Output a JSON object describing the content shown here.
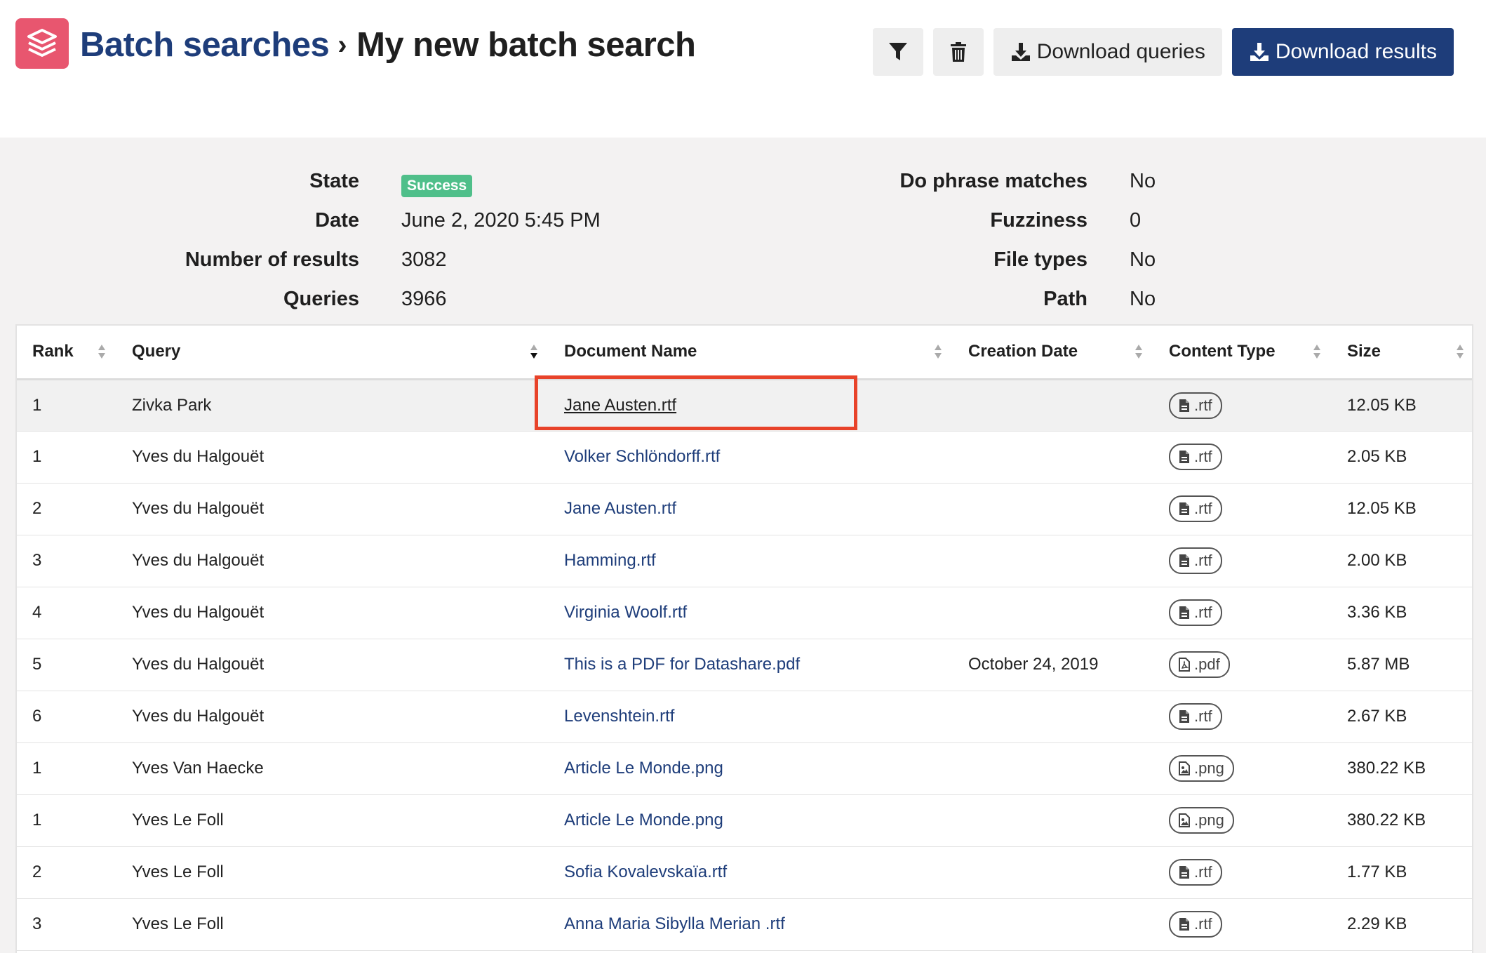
{
  "header": {
    "breadcrumb": "Batch searches",
    "separator": "›",
    "title": "My new batch search",
    "logo_icon": "layers-icon",
    "brand_color": "#e8566f",
    "accent_color": "#1e3d7a"
  },
  "toolbar": {
    "filter_icon": "filter-icon",
    "delete_icon": "trash-icon",
    "download_queries_label": "Download queries",
    "download_results_label": "Download results"
  },
  "info": {
    "left": [
      {
        "label": "State",
        "value": "Success",
        "badge": true
      },
      {
        "label": "Date",
        "value": "June 2, 2020 5:45 PM"
      },
      {
        "label": "Number of results",
        "value": "3082"
      },
      {
        "label": "Queries",
        "value": "3966"
      }
    ],
    "right": [
      {
        "label": "Do phrase matches",
        "value": "No"
      },
      {
        "label": "Fuzziness",
        "value": "0"
      },
      {
        "label": "File types",
        "value": "No"
      },
      {
        "label": "Path",
        "value": "No"
      }
    ]
  },
  "table": {
    "columns": [
      "Rank",
      "Query",
      "Document Name",
      "Creation Date",
      "Content Type",
      "Size"
    ],
    "rows": [
      {
        "rank": "1",
        "query": "Zivka Park",
        "document": "Jane Austen.rtf",
        "date": "",
        "type": ".rtf",
        "size": "12.05 KB"
      },
      {
        "rank": "1",
        "query": "Yves du Halgouët",
        "document": "Volker Schlöndorff.rtf",
        "date": "",
        "type": ".rtf",
        "size": "2.05 KB"
      },
      {
        "rank": "2",
        "query": "Yves du Halgouët",
        "document": "Jane Austen.rtf",
        "date": "",
        "type": ".rtf",
        "size": "12.05 KB"
      },
      {
        "rank": "3",
        "query": "Yves du Halgouët",
        "document": "Hamming.rtf",
        "date": "",
        "type": ".rtf",
        "size": "2.00 KB"
      },
      {
        "rank": "4",
        "query": "Yves du Halgouët",
        "document": "Virginia Woolf.rtf",
        "date": "",
        "type": ".rtf",
        "size": "3.36 KB"
      },
      {
        "rank": "5",
        "query": "Yves du Halgouët",
        "document": "This is a PDF for Datashare.pdf",
        "date": "October 24, 2019",
        "type": ".pdf",
        "size": "5.87 MB"
      },
      {
        "rank": "6",
        "query": "Yves du Halgouët",
        "document": "Levenshtein.rtf",
        "date": "",
        "type": ".rtf",
        "size": "2.67 KB"
      },
      {
        "rank": "1",
        "query": "Yves Van Haecke",
        "document": "Article Le Monde.png",
        "date": "",
        "type": ".png",
        "size": "380.22 KB"
      },
      {
        "rank": "1",
        "query": "Yves Le Foll",
        "document": "Article Le Monde.png",
        "date": "",
        "type": ".png",
        "size": "380.22 KB"
      },
      {
        "rank": "2",
        "query": "Yves Le Foll",
        "document": "Sofia Kovalevskaïa.rtf",
        "date": "",
        "type": ".rtf",
        "size": "1.77 KB"
      },
      {
        "rank": "3",
        "query": "Yves Le Foll",
        "document": "Anna Maria Sibylla Merian .rtf",
        "date": "",
        "type": ".rtf",
        "size": "2.29 KB"
      }
    ]
  }
}
